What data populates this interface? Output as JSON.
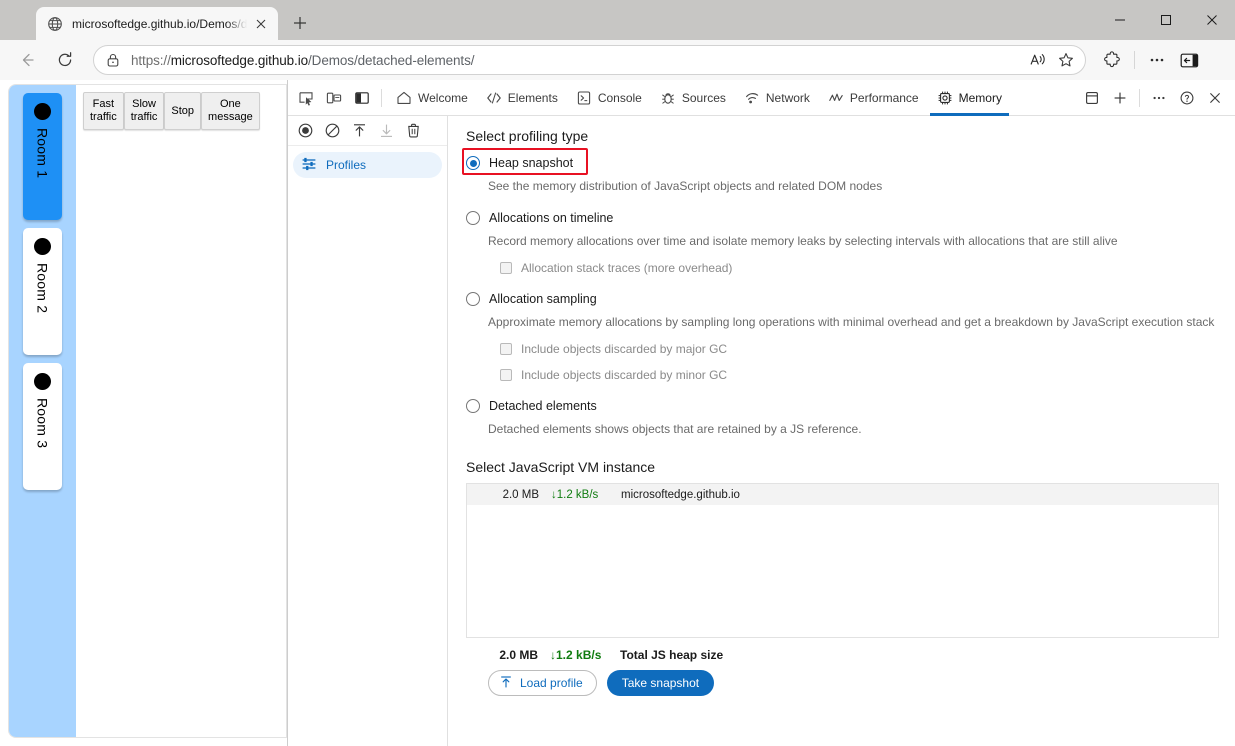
{
  "browser": {
    "tab": {
      "title": "microsoftedge.github.io/Demos/d",
      "favicon": "globe-icon",
      "close": "close-icon"
    },
    "new_tab": "+",
    "window_controls": {
      "minimize": "minimize-icon",
      "maximize": "maximize-icon",
      "close": "close-icon"
    },
    "toolbar": {
      "back": "back-arrow-icon",
      "reload": "reload-icon",
      "lock": "lock-icon",
      "url_scheme": "https://",
      "url_host": "microsoftedge.github.io",
      "url_path": "/Demos/detached-elements/",
      "read_aloud": "read-aloud-icon",
      "favorite": "star-icon",
      "extensions": "puzzle-piece-icon",
      "settings_more": "ellipsis-icon",
      "sidebar": "sidebar-icon"
    }
  },
  "page": {
    "rooms": [
      {
        "label": "Room 1",
        "active": true
      },
      {
        "label": "Room 2",
        "active": false
      },
      {
        "label": "Room 3",
        "active": false
      }
    ],
    "buttons": [
      "Fast\ntraffic",
      "Slow\ntraffic",
      "Stop",
      "One\nmessage"
    ]
  },
  "devtools": {
    "left_icons": [
      "inspect-element-icon",
      "device-toolbar-icon",
      "dock-side-icon"
    ],
    "tabs": [
      {
        "label": "Welcome",
        "icon": "home-icon",
        "selected": false
      },
      {
        "label": "Elements",
        "icon": "code-brackets-icon",
        "selected": false
      },
      {
        "label": "Console",
        "icon": "console-icon",
        "selected": false
      },
      {
        "label": "Sources",
        "icon": "bug-icon",
        "selected": false
      },
      {
        "label": "Network",
        "icon": "wifi-icon",
        "selected": false
      },
      {
        "label": "Performance",
        "icon": "performance-icon",
        "selected": false
      },
      {
        "label": "Memory",
        "icon": "memory-chip-icon",
        "selected": true
      }
    ],
    "right_icons": [
      "drawer-icon",
      "more-tabs-plus-icon",
      "ellipsis-icon",
      "help-icon",
      "close-icon"
    ],
    "sidebar": {
      "toolbar_icons": [
        "record-icon",
        "clear-icon",
        "load-icon",
        "save-icon",
        "delete-icon"
      ],
      "items": [
        {
          "label": "Profiles",
          "icon": "profiles-icon",
          "selected": true
        }
      ]
    },
    "main": {
      "profiling_title": "Select profiling type",
      "options": [
        {
          "label": "Heap snapshot",
          "selected": true,
          "description": "See the memory distribution of JavaScript objects and related DOM nodes",
          "checkboxes": []
        },
        {
          "label": "Allocations on timeline",
          "selected": false,
          "description": "Record memory allocations over time and isolate memory leaks by selecting intervals with allocations that are still alive",
          "checkboxes": [
            {
              "label": "Allocation stack traces (more overhead)",
              "checked": false
            }
          ]
        },
        {
          "label": "Allocation sampling",
          "selected": false,
          "description": "Approximate memory allocations by sampling long operations with minimal overhead and get a breakdown by JavaScript execution stack",
          "checkboxes": [
            {
              "label": "Include objects discarded by major GC",
              "checked": false
            },
            {
              "label": "Include objects discarded by minor GC",
              "checked": false
            }
          ]
        },
        {
          "label": "Detached elements",
          "selected": false,
          "description": "Detached elements shows objects that are retained by a JS reference.",
          "checkboxes": []
        }
      ],
      "vm_title": "Select JavaScript VM instance",
      "vm_columns": [
        "size",
        "rate",
        "name"
      ],
      "vm_rows": [
        {
          "size": "2.0 MB",
          "rate": "1.2 kB/s",
          "rate_arrow": "↓",
          "name": "microsoftedge.github.io"
        }
      ],
      "footer": {
        "total_size": "2.0 MB",
        "total_rate": "1.2 kB/s",
        "total_rate_arrow": "↓",
        "total_label": "Total JS heap size",
        "load_profile_label": "Load profile",
        "load_profile_icon": "upload-arrow-icon",
        "take_snapshot_label": "Take snapshot"
      }
    }
  },
  "colors": {
    "accent_blue": "#0f6cbd",
    "highlight_red": "#e81123",
    "rate_green": "#107c10",
    "room_active_blue": "#1e90f5",
    "rail_blue": "#a8d4ff"
  }
}
